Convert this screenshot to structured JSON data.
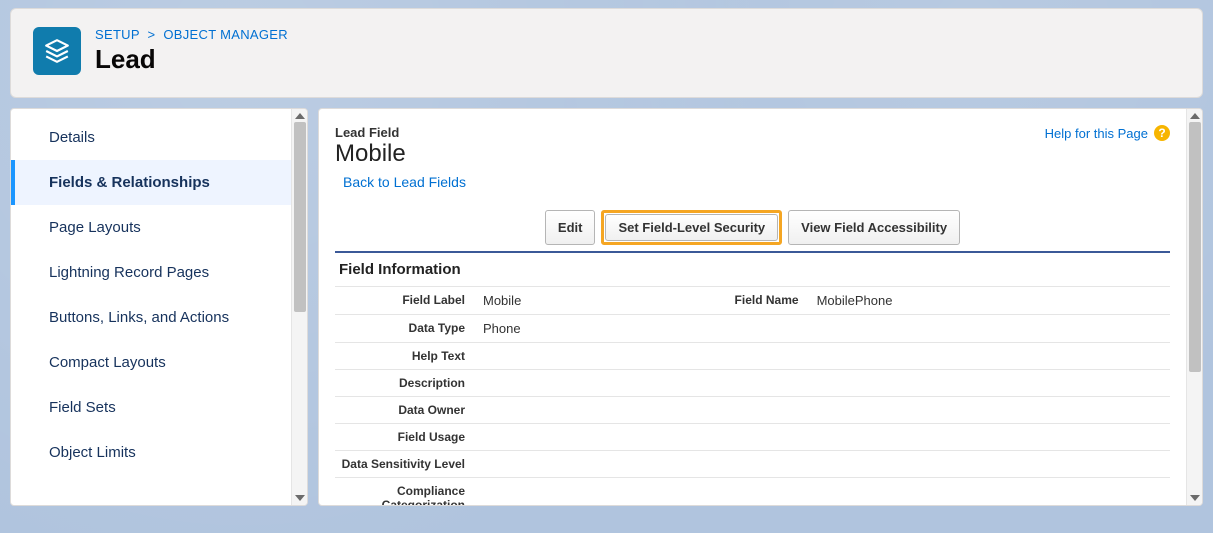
{
  "breadcrumb": {
    "setup": "SETUP",
    "objectManager": "OBJECT MANAGER"
  },
  "page": {
    "title": "Lead"
  },
  "sidebar": {
    "items": [
      {
        "label": "Details"
      },
      {
        "label": "Fields & Relationships"
      },
      {
        "label": "Page Layouts"
      },
      {
        "label": "Lightning Record Pages"
      },
      {
        "label": "Buttons, Links, and Actions"
      },
      {
        "label": "Compact Layouts"
      },
      {
        "label": "Field Sets"
      },
      {
        "label": "Object Limits"
      }
    ],
    "activeIndex": 1
  },
  "main": {
    "kicker": "Lead Field",
    "title": "Mobile",
    "backLink": "Back to Lead Fields",
    "helpLink": "Help for this Page",
    "buttons": {
      "edit": "Edit",
      "setFls": "Set Field-Level Security",
      "viewAccess": "View Field Accessibility"
    },
    "sectionTitle": "Field Information",
    "fields": {
      "fieldLabel": {
        "label": "Field Label",
        "value": "Mobile"
      },
      "fieldName": {
        "label": "Field Name",
        "value": "MobilePhone"
      },
      "dataType": {
        "label": "Data Type",
        "value": "Phone"
      },
      "helpText": {
        "label": "Help Text",
        "value": ""
      },
      "description": {
        "label": "Description",
        "value": ""
      },
      "dataOwner": {
        "label": "Data Owner",
        "value": ""
      },
      "fieldUsage": {
        "label": "Field Usage",
        "value": ""
      },
      "sensitivity": {
        "label": "Data Sensitivity Level",
        "value": ""
      },
      "compliance": {
        "label": "Compliance Categorization",
        "value": ""
      }
    }
  }
}
